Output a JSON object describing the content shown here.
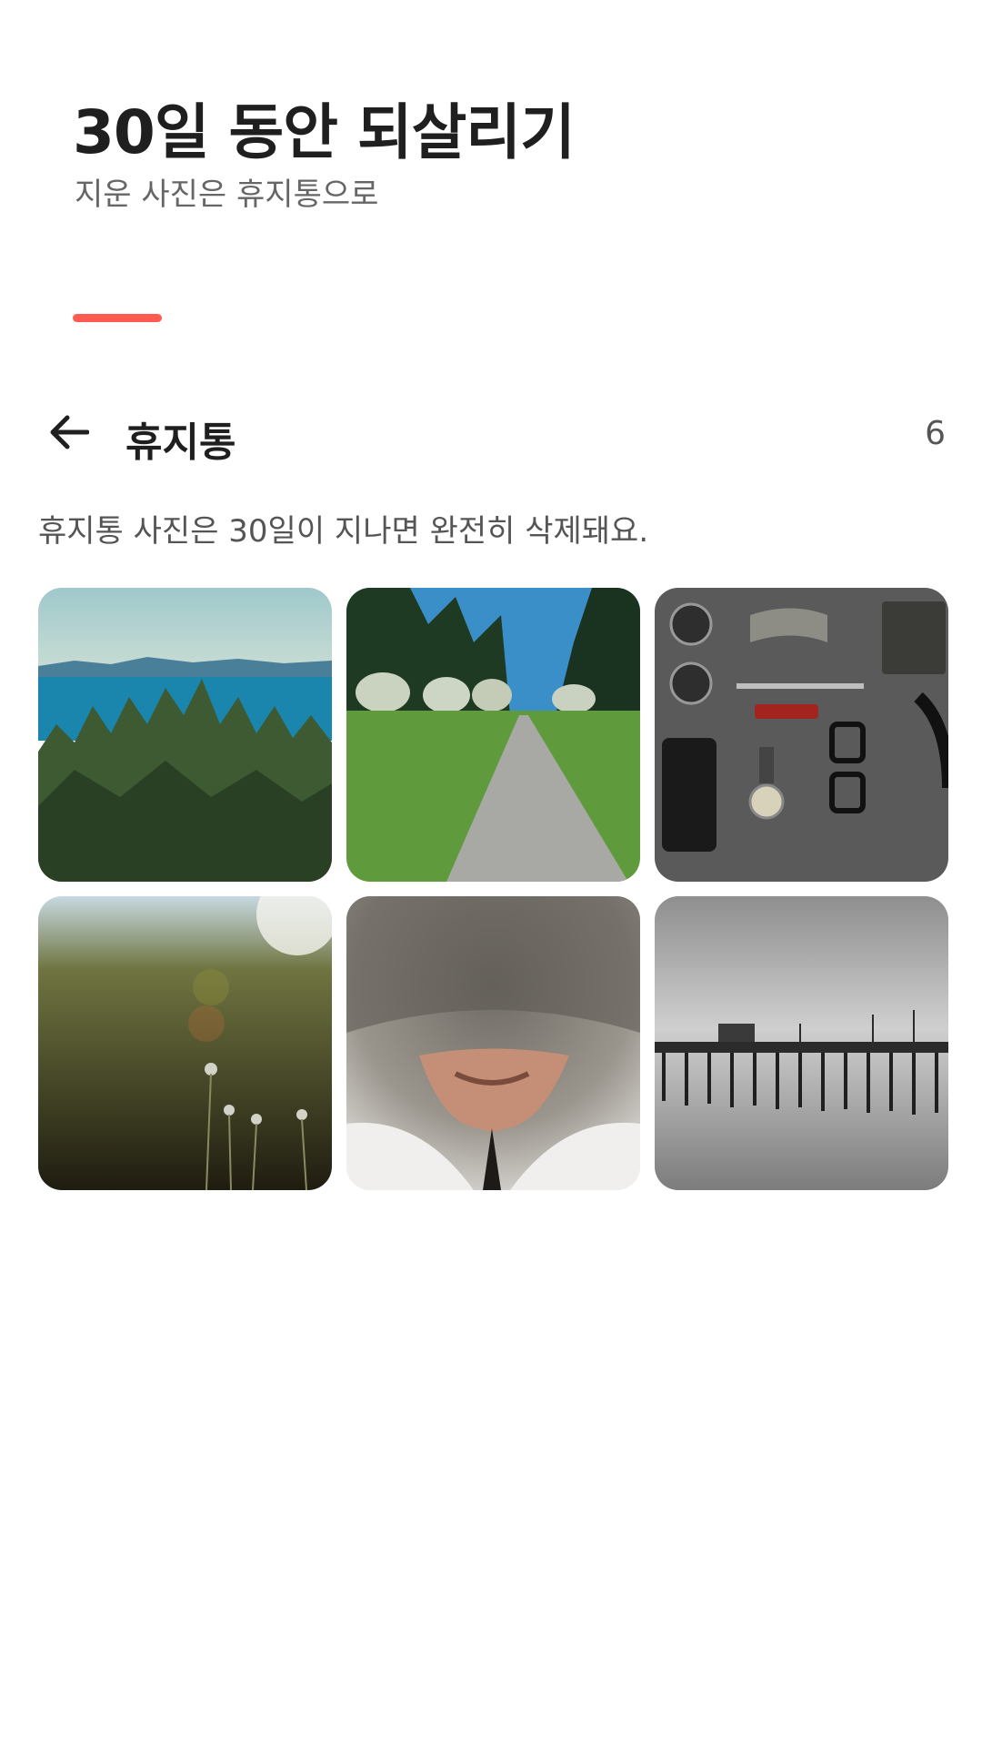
{
  "header": {
    "title": "30일 동안 되살리기",
    "subtitle": "지운 사진은 휴지통으로"
  },
  "progress": {
    "value": 0.17,
    "color": "#ff5a4f"
  },
  "trash": {
    "back_icon": "arrow-left-icon",
    "title": "휴지통",
    "count": "6",
    "notice": "휴지통 사진은 30일이 지나면 완전히 삭제돼요."
  },
  "photos": [
    {
      "subject": "sea-and-trees"
    },
    {
      "subject": "grass-path"
    },
    {
      "subject": "flat-lay-objects"
    },
    {
      "subject": "meadow-flowers"
    },
    {
      "subject": "cat-nose"
    },
    {
      "subject": "pier-bw"
    }
  ]
}
